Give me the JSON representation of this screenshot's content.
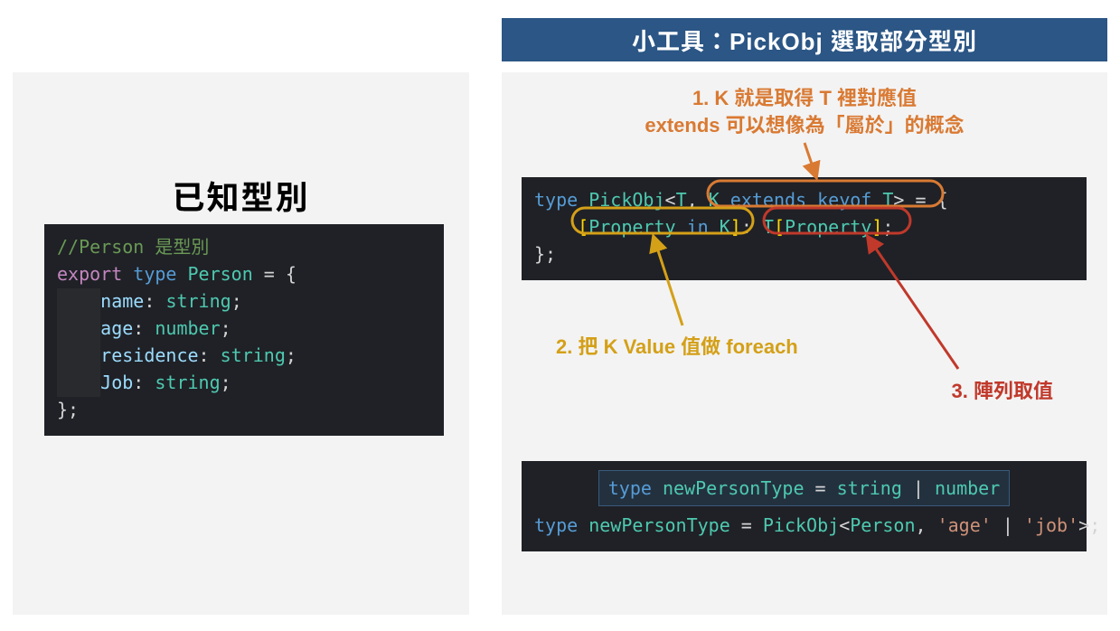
{
  "title": "小工具：PickObj 選取部分型別",
  "left": {
    "heading": "已知型別",
    "code": {
      "comment": "//Person 是型別",
      "l1_export": "export",
      "l1_type": "type",
      "l1_name": "Person",
      "l1_eq": " = {",
      "p1_name": "name",
      "p1_type": "string",
      "p2_name": "age",
      "p2_type": "number",
      "p3_name": "residence",
      "p3_type": "string",
      "p4_name": "Job",
      "p4_type": "string",
      "close": "};"
    }
  },
  "right": {
    "annotations": {
      "a1_line1": "1. K 就是取得 T 裡對應值",
      "a1_line2": "extends 可以想像為「屬於」的概念",
      "a2": "2. 把 K Value 值做 foreach",
      "a3": "3. 陣列取值"
    },
    "code1": {
      "kw_type": "type",
      "name": "PickObj",
      "lt": "<",
      "t": "T",
      "comma": ",",
      "k": " K ",
      "extends": "extends",
      "keyof": " keyof ",
      "t2": "T",
      "gt": ">",
      "eq_brace": " = {",
      "lbr": "[",
      "prop": "Property",
      "in": " in ",
      "k2": "K",
      "rbr": "]",
      "colon": ": ",
      "t3": "T",
      "lbr2": "[",
      "prop2": "Property",
      "rbr2": "]",
      "semi": ";",
      "close": "};"
    },
    "code2": {
      "inner_kw": "type",
      "inner_name": "newPersonType",
      "inner_eq": " = ",
      "inner_t1": "string",
      "inner_pipe": " | ",
      "inner_t2": "number",
      "kw": "type",
      "name": "newPersonType",
      "eq": " = ",
      "pick": "PickObj",
      "lt": "<",
      "person": "Person",
      "comma": ", ",
      "s1": "'age'",
      "pipe": " | ",
      "s2": "'job'",
      "gt": ">",
      "semi": ";"
    }
  }
}
